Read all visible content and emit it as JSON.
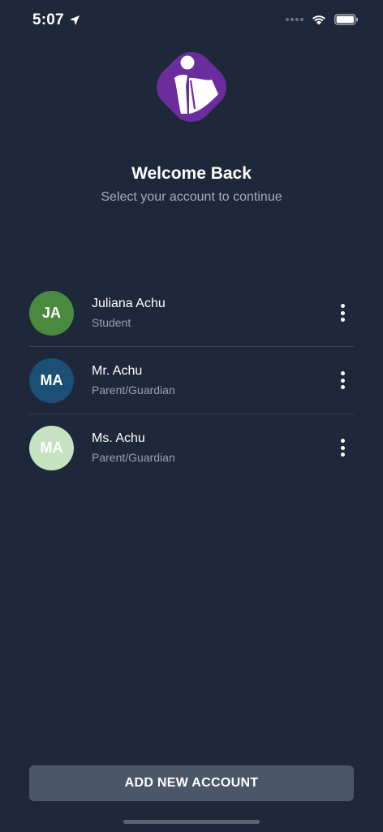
{
  "status_bar": {
    "time": "5:07",
    "icons": [
      "location-arrow-icon",
      "signal-dots-icon",
      "wifi-icon",
      "battery-icon"
    ]
  },
  "brand": {
    "logo_icon": "reader-logo-icon",
    "logo_color": "#6b2d9c"
  },
  "header": {
    "title": "Welcome Back",
    "subtitle": "Select your account to continue"
  },
  "accounts": [
    {
      "initials": "JA",
      "name": "Juliana Achu",
      "role": "Student",
      "avatar_color": "#4a8a3f",
      "avatar_text_color": "#ffffff"
    },
    {
      "initials": "MA",
      "name": "Mr. Achu",
      "role": "Parent/Guardian",
      "avatar_color": "#1b4f75",
      "avatar_text_color": "#ffffff"
    },
    {
      "initials": "MA",
      "name": "Ms. Achu",
      "role": "Parent/Guardian",
      "avatar_color": "#c6e3c1",
      "avatar_text_color": "#ffffff"
    }
  ],
  "actions": {
    "add_account_label": "ADD NEW ACCOUNT",
    "more_icon": "more-vertical-icon"
  }
}
